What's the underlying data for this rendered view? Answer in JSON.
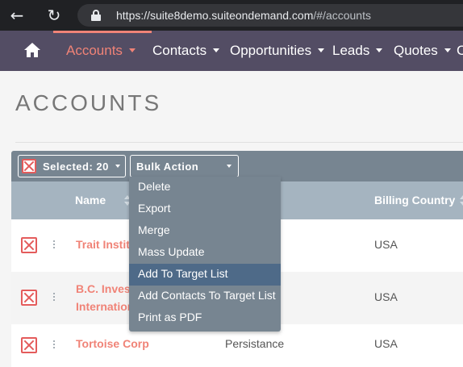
{
  "browser": {
    "url_host": "https://suite8demo.suiteondemand.com",
    "url_path": "/#/accounts"
  },
  "nav": {
    "items": [
      {
        "label": "Accounts",
        "active": true
      },
      {
        "label": "Contacts"
      },
      {
        "label": "Opportunities"
      },
      {
        "label": "Leads"
      },
      {
        "label": "Quotes"
      }
    ],
    "partial_label": "C",
    "accent_color": "#f08377",
    "bar_color": "#534d64"
  },
  "page": {
    "title": "ACCOUNTS"
  },
  "toolbar": {
    "selected_label": "Selected: 20",
    "bulk_action_label": "Bulk Action"
  },
  "bulk_menu": {
    "items": [
      "Delete",
      "Export",
      "Merge",
      "Mass Update",
      "Add To Target List",
      "Add Contacts To Target List",
      "Print as PDF"
    ],
    "highlighted": "Add To Target List"
  },
  "table": {
    "columns": [
      "Name",
      "Billing Country"
    ],
    "rows": [
      {
        "name_lines": [
          "Trait Instit"
        ],
        "col3": "",
        "country": "USA"
      },
      {
        "name_lines": [
          "B.C. Invest",
          "Internation"
        ],
        "col3": "",
        "country": "USA"
      },
      {
        "name_lines": [
          "Tortoise Corp"
        ],
        "col3": "Persistance",
        "country": "USA"
      }
    ]
  }
}
